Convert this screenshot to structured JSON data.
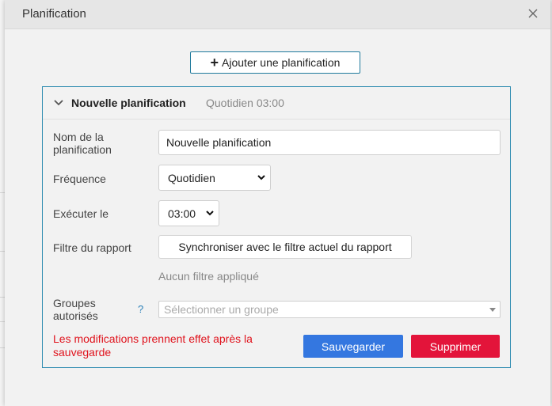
{
  "dialog": {
    "title": "Planification"
  },
  "toolbar": {
    "add_label": "Ajouter une planification"
  },
  "schedule": {
    "header_title": "Nouvelle planification",
    "header_subtitle": "Quotidien 03:00",
    "name_label": "Nom de la planification",
    "name_value": "Nouvelle planification",
    "frequency_label": "Fréquence",
    "frequency_value": "Quotidien",
    "time_label": "Exécuter le",
    "time_value": "03:00",
    "filter_label": "Filtre du rapport",
    "sync_button_label": "Synchroniser avec le filtre actuel du rapport",
    "filter_status": "Aucun filtre appliqué",
    "groups_label": "Groupes autorisés",
    "groups_help": "?",
    "groups_placeholder": "Sélectionner un groupe",
    "warning": "Les modifications prennent effet après la sauvegarde",
    "save_label": "Sauvegarder",
    "delete_label": "Supprimer"
  },
  "icons": {
    "close": "close-icon",
    "plus": "plus-icon",
    "collapse": "chevron-down-icon",
    "select_arrow": "chevron-down-icon"
  },
  "colors": {
    "accent_border": "#2d8bb0",
    "save_button": "#3477e0",
    "delete_button": "#e3143a",
    "warning_text": "#e0141e"
  }
}
